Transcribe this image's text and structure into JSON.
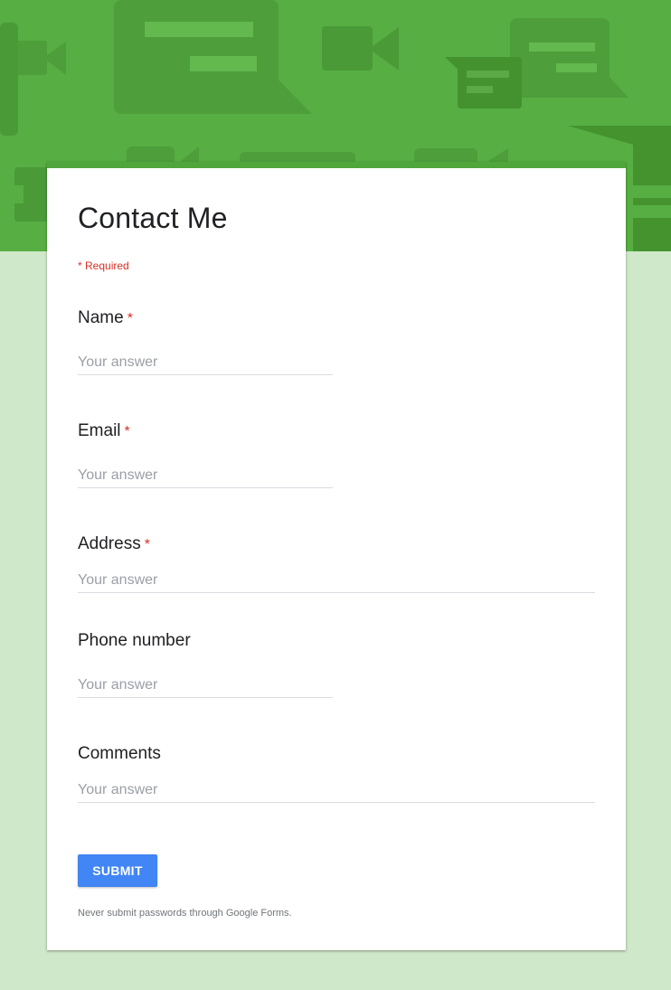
{
  "header": {
    "accent_color": "#57ae42",
    "pattern": "chat-and-video-icons"
  },
  "form": {
    "title": "Contact Me",
    "required_note": "* Required",
    "questions": [
      {
        "label": "Name",
        "required": true,
        "star": "*",
        "placeholder": "Your answer",
        "value": ""
      },
      {
        "label": "Email",
        "required": true,
        "star": "*",
        "placeholder": "Your answer",
        "value": ""
      },
      {
        "label": "Address",
        "required": true,
        "star": "*",
        "placeholder": "Your answer",
        "value": ""
      },
      {
        "label": "Phone number",
        "required": false,
        "placeholder": "Your answer",
        "value": ""
      },
      {
        "label": "Comments",
        "required": false,
        "placeholder": "Your answer",
        "value": ""
      }
    ],
    "submit_label": "SUBMIT",
    "submit_color": "#4285f4",
    "footer_note": "Never submit passwords through Google Forms."
  }
}
